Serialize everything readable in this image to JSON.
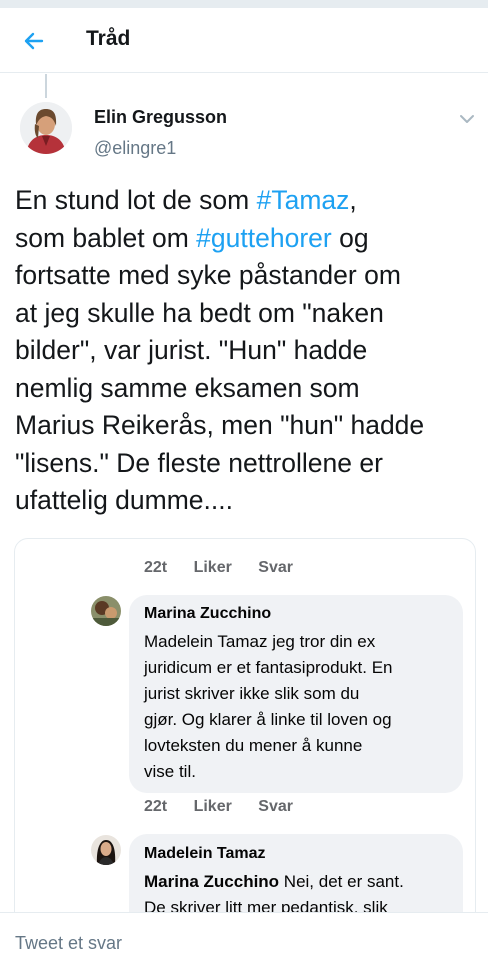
{
  "header": {
    "title": "Tråd",
    "back_icon": "back-arrow-icon",
    "accent": "#1da1f2"
  },
  "tweet": {
    "author_name": "Elin Gregusson",
    "author_handle": "@elingre1",
    "text_lines": [
      [
        "En stund lot de som ",
        "#Tamaz",
        ","
      ],
      [
        "som bablet om ",
        "#guttehorer",
        " og"
      ],
      [
        "fortsatte med syke påstander om",
        "",
        ""
      ],
      [
        "at jeg skulle ha bedt om \"naken",
        "",
        ""
      ],
      [
        "bilder\", var jurist. \"Hun\" hadde",
        "",
        ""
      ],
      [
        "nemlig samme eksamen som",
        "",
        ""
      ],
      [
        "Marius Reikerås, men \"hun\" hadde",
        "",
        ""
      ],
      [
        "\"lisens.\" De fleste nettrollene er",
        "",
        ""
      ],
      [
        "ufattelig dumme....",
        "",
        ""
      ]
    ]
  },
  "embed": {
    "meta1": {
      "time": "22t",
      "like": "Liker",
      "reply": "Svar"
    },
    "comment1": {
      "name": "Marina Zucchino",
      "lines": [
        "Madelein Tamaz jeg tror din ex",
        "juridicum er et fantasiprodukt. En",
        "jurist skriver ikke slik som du",
        "gjør. Og klarer å linke til loven og",
        "lovteksten du mener å kunne",
        "vise til."
      ]
    },
    "meta2": {
      "time": "22t",
      "like": "Liker",
      "reply": "Svar"
    },
    "comment2": {
      "name": "Madelein Tamaz",
      "mention": "Marina Zucchino",
      "line1_rest": " Nei, det er sant.",
      "line2": "De skriver litt mer pedantisk, slik"
    }
  },
  "footer": {
    "reply_placeholder": "Tweet et svar"
  }
}
